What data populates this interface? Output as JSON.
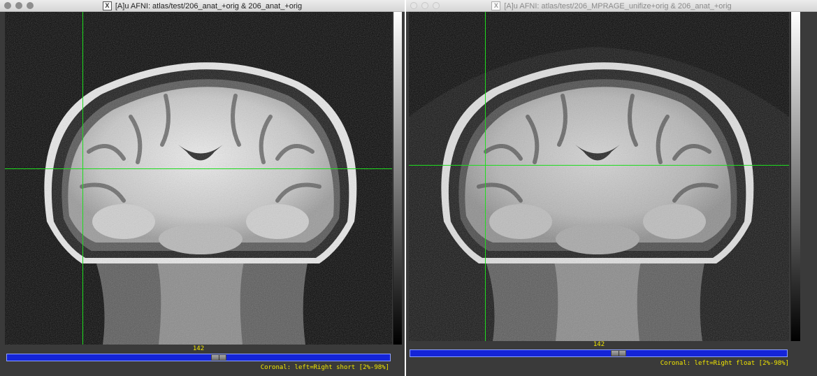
{
  "windows": [
    {
      "title": "[A]u AFNI: atlas/test/206_anat_+orig & 206_anat_+orig",
      "active": true,
      "slice_number": "142",
      "slider_position": 0.53,
      "status": "Coronal: left=Right short [2%-98%]"
    },
    {
      "title": "[A]u AFNI: atlas/test/206_MPRAGE_unifize+orig & 206_anat_+orig",
      "active": false,
      "slice_number": "142",
      "slider_position": 0.53,
      "status": "Coronal: left=Right float [2%-98%]"
    }
  ],
  "colors": {
    "crosshair": "#1fdc1f",
    "slider_track": "#1424d8",
    "label_text": "#f2e700",
    "frame": "#3a3a3a"
  },
  "icons": {
    "title_icon": "x11-icon"
  }
}
